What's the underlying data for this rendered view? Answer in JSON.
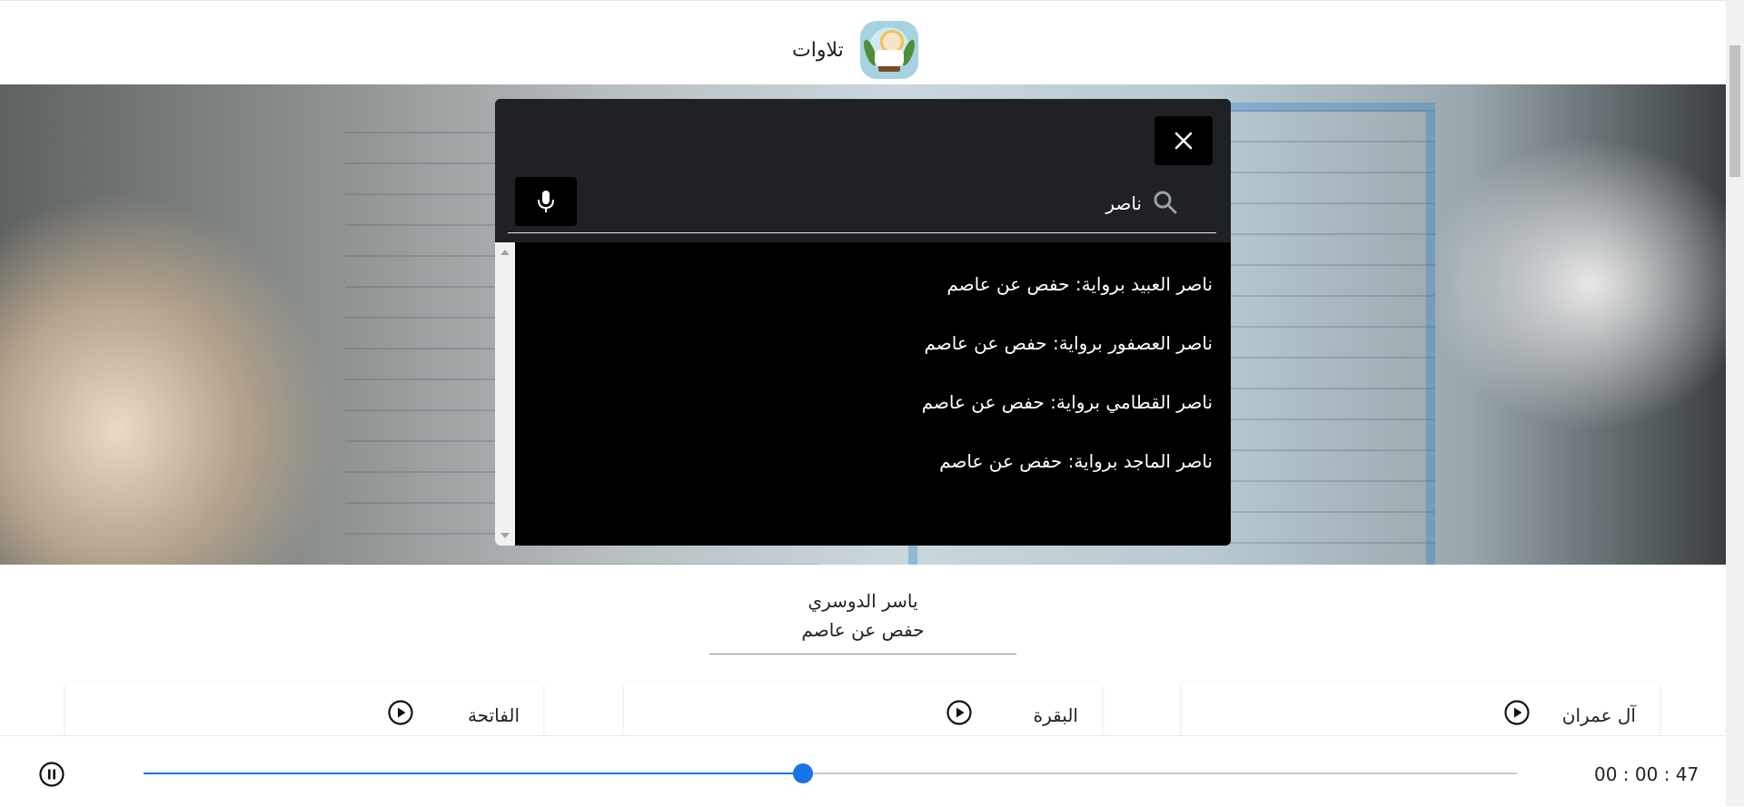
{
  "header": {
    "brand_name": "تلاوات"
  },
  "search": {
    "query": "ناصر",
    "results": [
      "ناصر العبيد  برواية: حفص عن عاصم",
      "ناصر العصفور  برواية: حفص عن عاصم",
      "ناصر القطامي  برواية: حفص عن عاصم",
      "ناصر الماجد  برواية: حفص عن عاصم"
    ]
  },
  "reciter": {
    "name": "ياسر الدوسري",
    "narration": "حفص عن عاصم"
  },
  "surahs": [
    "الفاتحة",
    "البقرة",
    "آل عمران"
  ],
  "player": {
    "time": "00 : 00 : 47",
    "progress_fraction": 0.48,
    "state": "playing"
  },
  "colors": {
    "accent": "#1a73e8",
    "overlay_bg": "#202124",
    "results_bg": "#000000"
  }
}
